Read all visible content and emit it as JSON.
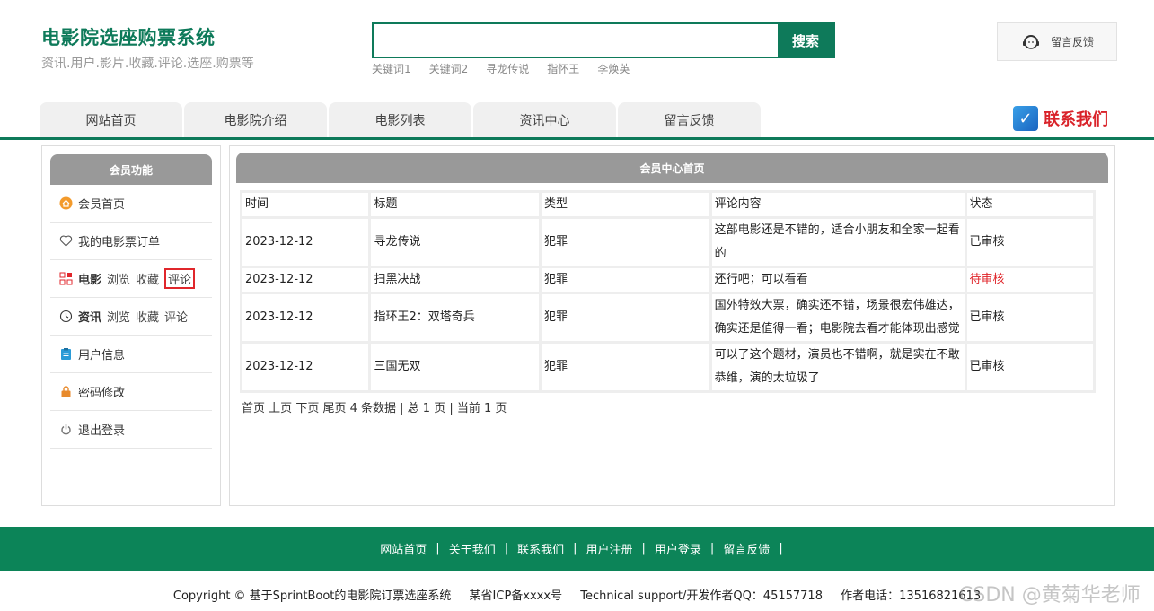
{
  "brand": {
    "title": "电影院选座购票系统",
    "subtitle": "资讯.用户.影片.收藏.评论.选座.购票等"
  },
  "search": {
    "value": "",
    "placeholder": "",
    "button": "搜索"
  },
  "keywords": [
    "关键词1",
    "关键词2",
    "寻龙传说",
    "指怀王",
    "李焕英"
  ],
  "feedback_button": "留言反馈",
  "nav": [
    "网站首页",
    "电影院介绍",
    "电影列表",
    "资讯中心",
    "留言反馈"
  ],
  "contact": {
    "label": "联系我们"
  },
  "sidebar": {
    "title": "会员功能",
    "items": [
      {
        "label": "会员首页"
      },
      {
        "label": "我的电影票订单"
      },
      {
        "label": "电影",
        "links": [
          "浏览",
          "收藏",
          "评论"
        ]
      },
      {
        "label": "资讯",
        "links": [
          "浏览",
          "收藏",
          "评论"
        ]
      },
      {
        "label": "用户信息"
      },
      {
        "label": "密码修改"
      },
      {
        "label": "退出登录"
      }
    ]
  },
  "main": {
    "title": "会员中心首页",
    "columns": [
      "时间",
      "标题",
      "类型",
      "评论内容",
      "状态"
    ],
    "rows": [
      {
        "time": "2023-12-12",
        "title": "寻龙传说",
        "type": "犯罪",
        "comment": "这部电影还是不错的，适合小朋友和全家一起看的",
        "status": "已审核"
      },
      {
        "time": "2023-12-12",
        "title": "扫黑决战",
        "type": "犯罪",
        "comment": "还行吧；可以看看",
        "status": "待审核"
      },
      {
        "time": "2023-12-12",
        "title": "指环王2：双塔奇兵",
        "type": "犯罪",
        "comment": "国外特效大票，确实还不错，场景很宏伟雄达，确实还是值得一看；电影院去看才能体现出感觉",
        "status": "已审核"
      },
      {
        "time": "2023-12-12",
        "title": "三国无双",
        "type": "犯罪",
        "comment": "可以了这个题材，演员也不错啊，就是实在不敢恭维，演的太垃圾了",
        "status": "已审核"
      }
    ],
    "pager": {
      "first": "首页",
      "prev": "上页",
      "next": "下页",
      "last": "尾页",
      "summary": "4 条数据 | 总 1 页 | 当前 1 页"
    }
  },
  "footer": {
    "links": [
      "网站首页",
      "关于我们",
      "联系我们",
      "用户注册",
      "用户登录",
      "留言反馈"
    ],
    "separator": "|",
    "copyright": "Copyright © 基于SprintBoot的电影院订票选座系统",
    "icp": "某省ICP备xxxx号",
    "support": "Technical support/开发作者QQ：45157718",
    "phone": "作者电话：13516821613"
  },
  "watermark": "CSDN @黄菊华老师",
  "colors": {
    "accent": "#0e7a5a",
    "footer": "#0c8458",
    "highlight": "#e0262b",
    "header_gray": "#999999"
  }
}
